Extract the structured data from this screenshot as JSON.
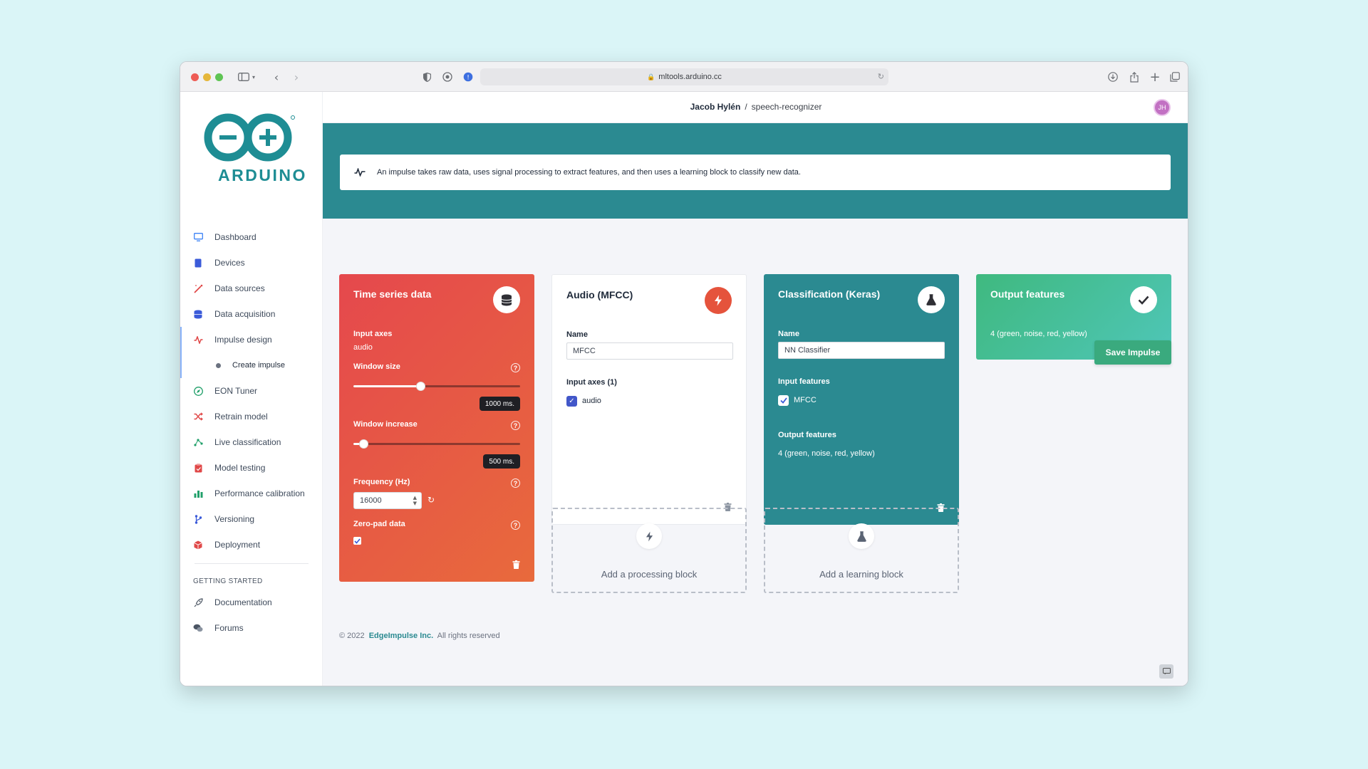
{
  "browser": {
    "url": "mltools.arduino.cc"
  },
  "brand": {
    "logo_text": "ARDUINO",
    "accent": "#1e8d94"
  },
  "sidebar": {
    "items": [
      {
        "label": "Dashboard",
        "icon": "monitor-icon",
        "color": "#3b82f6"
      },
      {
        "label": "Devices",
        "icon": "device-icon",
        "color": "#3b5bd9"
      },
      {
        "label": "Data sources",
        "icon": "wand-icon",
        "color": "#e04848"
      },
      {
        "label": "Data acquisition",
        "icon": "database-icon",
        "color": "#3b5bd9"
      },
      {
        "label": "Impulse design",
        "icon": "pulse-icon",
        "color": "#e04848"
      },
      {
        "label": "Create impulse",
        "icon": "dot-icon",
        "color": "#6b7280"
      },
      {
        "label": "EON Tuner",
        "icon": "compass-icon",
        "color": "#22a06b"
      },
      {
        "label": "Retrain model",
        "icon": "shuffle-icon",
        "color": "#e04848"
      },
      {
        "label": "Live classification",
        "icon": "scatter-icon",
        "color": "#22a06b"
      },
      {
        "label": "Model testing",
        "icon": "clipboard-icon",
        "color": "#e04848"
      },
      {
        "label": "Performance calibration",
        "icon": "bar-chart-icon",
        "color": "#22a06b"
      },
      {
        "label": "Versioning",
        "icon": "branch-icon",
        "color": "#3b5bd9"
      },
      {
        "label": "Deployment",
        "icon": "box-icon",
        "color": "#e04848"
      }
    ],
    "section_label": "GETTING STARTED",
    "extra": [
      {
        "label": "Documentation",
        "icon": "rocket-icon"
      },
      {
        "label": "Forums",
        "icon": "chat-icon"
      }
    ]
  },
  "header": {
    "user": "Jacob Hylén",
    "separator": "/",
    "project": "speech-recognizer",
    "avatar_initials": "JH"
  },
  "info_banner": {
    "text": "An impulse takes raw data, uses signal processing to extract features, and then uses a learning block to classify new data."
  },
  "time_series": {
    "title": "Time series data",
    "input_axes_label": "Input axes",
    "input_axes_value": "audio",
    "window_size_label": "Window size",
    "window_size_value": "1000 ms.",
    "window_size_fraction": 0.4,
    "window_increase_label": "Window increase",
    "window_increase_value": "500 ms.",
    "window_increase_fraction": 0.06,
    "frequency_label": "Frequency (Hz)",
    "frequency_value": "16000",
    "zero_pad_label": "Zero-pad data",
    "zero_pad_checked": true,
    "color_start": "#e5484d",
    "color_end": "#e86a3c"
  },
  "audio_block": {
    "title": "Audio (MFCC)",
    "name_label": "Name",
    "name_value": "MFCC",
    "input_axes_label": "Input axes (1)",
    "axes": [
      "audio"
    ],
    "badge_color": "#e5533c"
  },
  "classification_block": {
    "title": "Classification (Keras)",
    "name_label": "Name",
    "name_value": "NN Classifier",
    "input_features_label": "Input features",
    "input_features": [
      "MFCC"
    ],
    "output_features_label": "Output features",
    "output_features_value": "4 (green, noise, red, yellow)",
    "color": "#2b8a91"
  },
  "output_block": {
    "title": "Output features",
    "value": "4 (green, noise, red, yellow)",
    "color_start": "#3fb97f",
    "color_end": "#4fc6b8"
  },
  "save_button": "Save Impulse",
  "add_processing": "Add a processing block",
  "add_learning": "Add a learning block",
  "footer": {
    "prefix": "© 2022",
    "link": "EdgeImpulse Inc.",
    "suffix": "All rights reserved"
  }
}
